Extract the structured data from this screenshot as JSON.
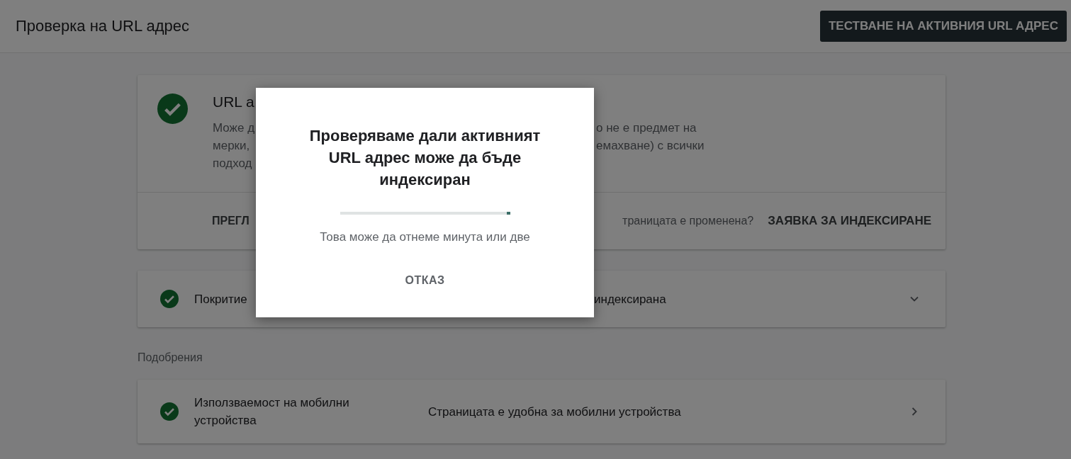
{
  "header": {
    "title": "Проверка на URL адрес",
    "test_button": "ТЕСТВАНЕ НА АКТИВНИЯ URL АДРЕС"
  },
  "status_card": {
    "title": "URL а",
    "lines": [
      {
        "left": "Може д",
        "right": "о не е предмет на"
      },
      {
        "left": "мерки,",
        "right": "емахване) с всички"
      },
      {
        "left": "подход"
      }
    ],
    "footer_left": "ПРЕГЛ",
    "question": "траницата е променена?",
    "request_button": "ЗАЯВКА ЗА ИНДЕКСИРАНЕ"
  },
  "coverage": {
    "label": "Покритие",
    "value": "индексирана",
    "expanded": false
  },
  "section_label": "Подобрения",
  "enhancements": [
    {
      "label": "Използваемост на мобилни устройства",
      "value": "Страницата е удобна за мобилни устройства"
    }
  ],
  "dialog": {
    "title": "Проверяваме дали активният URL адрес може да бъде индексиран",
    "note": "Това може да отнеме минута или две",
    "cancel": "ОТКАЗ",
    "level": 0.02
  }
}
